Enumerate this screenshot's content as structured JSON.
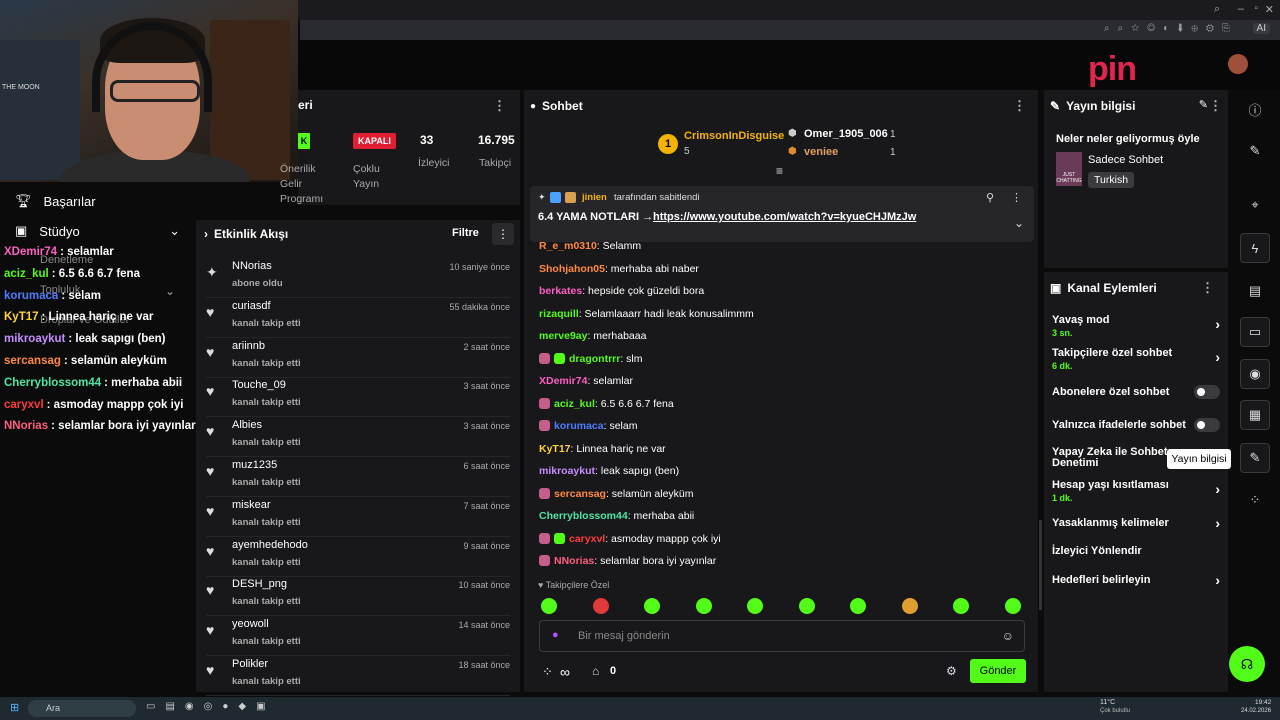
{
  "webcam": {
    "shelf_text": "THE MOON"
  },
  "stats": {
    "partial_title": "eri",
    "badge_left": "K",
    "label_left": "Önerilik\nGelir\nProgramı",
    "status": "KAPALI",
    "status_label": "Çoklu\nYayın",
    "viewers": "33",
    "viewers_label": "İzleyici",
    "followers": "16.795",
    "followers_label": "Takipçi"
  },
  "leftnav": {
    "achievements": "Başarılar",
    "studio": "Stüdyo",
    "denetleme": "Denetleme",
    "topluluk": "Topluluk",
    "dropslar": "Droplar ve Ödüller"
  },
  "overlay_chat": [
    {
      "user": "XDemir74",
      "msg": ": selamlar",
      "color": "#ff5ec4"
    },
    {
      "user": "aciz_kul",
      "msg": ": 6.5 6.6 6.7 fena",
      "color": "#53fc18"
    },
    {
      "user": "korumaca",
      "msg": ": selam",
      "color": "#4f7dff"
    },
    {
      "user": "KyT17",
      "msg": ": Linnea hariç ne var",
      "color": "#ffd23e"
    },
    {
      "user": "mikroaykut",
      "msg": ": leak sapıgı (ben)",
      "color": "#c78cff"
    },
    {
      "user": "sercansag",
      "msg": ": selamün aleyküm",
      "color": "#ff8a3d"
    },
    {
      "user": "Cherryblossom44",
      "msg": ": merhaba abii",
      "color": "#4ee6a4"
    },
    {
      "user": "caryxvl",
      "msg": ": asmoday mappp çok iyi",
      "color": "#ff3b3b"
    },
    {
      "user": "NNorias",
      "msg": ": selamlar bora iyi yayınlar",
      "color": "#ff5e7e"
    }
  ],
  "activity": {
    "title": "Etkinlik Akışı",
    "filter": "Filtre",
    "items": [
      {
        "name": "NNorias",
        "sub": "abone oldu",
        "time": "10 saniye önce",
        "icon": "✦"
      },
      {
        "name": "curiasdf",
        "sub": "kanalı takip etti",
        "time": "55 dakika önce",
        "icon": "♥"
      },
      {
        "name": "ariinnb",
        "sub": "kanalı takip etti",
        "time": "2 saat önce",
        "icon": "♥"
      },
      {
        "name": "Touche_09",
        "sub": "kanalı takip etti",
        "time": "3 saat önce",
        "icon": "♥"
      },
      {
        "name": "Albies",
        "sub": "kanalı takip etti",
        "time": "3 saat önce",
        "icon": "♥"
      },
      {
        "name": "muz1235",
        "sub": "kanalı takip etti",
        "time": "6 saat önce",
        "icon": "♥"
      },
      {
        "name": "miskear",
        "sub": "kanalı takip etti",
        "time": "7 saat önce",
        "icon": "♥"
      },
      {
        "name": "ayemhedehodo",
        "sub": "kanalı takip etti",
        "time": "9 saat önce",
        "icon": "♥"
      },
      {
        "name": "DESH_png",
        "sub": "kanalı takip etti",
        "time": "10 saat önce",
        "icon": "♥"
      },
      {
        "name": "yeowoll",
        "sub": "kanalı takip etti",
        "time": "14 saat önce",
        "icon": "♥"
      },
      {
        "name": "Polikler",
        "sub": "kanalı takip etti",
        "time": "18 saat önce",
        "icon": "♥"
      }
    ]
  },
  "chat": {
    "title": "Sohbet",
    "leader1": {
      "rank": "1",
      "name": "CrimsonInDisguise",
      "count": "5"
    },
    "leader2": {
      "name": "Omer_1905_006",
      "count": "1"
    },
    "leader3": {
      "name": "veniee",
      "count": "1"
    },
    "pinned_by_user": "jinien",
    "pinned_by_text": "tarafından sabitlendi",
    "pinned_msg": "6.4 YAMA NOTLARI →",
    "pinned_link": "https://www.youtube.com/watch?v=kyueCHJMzJw",
    "messages": [
      {
        "user": "R_e_m0310",
        "msg": ": Selamm",
        "color": "#ff8a3d",
        "badge": ""
      },
      {
        "user": "Shohjahon05",
        "msg": ": merhaba abi naber",
        "color": "#ff8a3d",
        "badge": ""
      },
      {
        "user": "berkates",
        "msg": ": hepside çok güzeldi bora",
        "color": "#ff5ec4",
        "badge": ""
      },
      {
        "user": "rizaquill",
        "msg": ": Selamlaaarr hadi leak konusalimmm",
        "color": "#53fc18",
        "badge": ""
      },
      {
        "user": "merve9ay",
        "msg": ": merhabaaa",
        "color": "#53fc18",
        "badge": ""
      },
      {
        "user": "dragontrrr",
        "msg": ": slm",
        "color": "#53fc18",
        "badge": "two"
      },
      {
        "user": "XDemir74",
        "msg": ": selamlar",
        "color": "#ff5ec4",
        "badge": ""
      },
      {
        "user": "aciz_kul",
        "msg": ": 6.5 6.6 6.7 fena",
        "color": "#53fc18",
        "badge": "one"
      },
      {
        "user": "korumaca",
        "msg": ": selam",
        "color": "#4f7dff",
        "badge": "one"
      },
      {
        "user": "KyT17",
        "msg": ": Linnea hariç ne var",
        "color": "#ffd23e",
        "badge": ""
      },
      {
        "user": "mikroaykut",
        "msg": ": leak sapıgı (ben)",
        "color": "#c78cff",
        "badge": ""
      },
      {
        "user": "sercansag",
        "msg": ": selamün aleyküm",
        "color": "#ff8a3d",
        "badge": "one"
      },
      {
        "user": "Cherryblossom44",
        "msg": ": merhaba abii",
        "color": "#4ee6a4",
        "badge": ""
      },
      {
        "user": "caryxvl",
        "msg": ": asmoday mappp çok iyi",
        "color": "#ff3b3b",
        "badge": "two"
      },
      {
        "user": "NNorias",
        "msg": ": selamlar bora iyi yayınlar",
        "color": "#ff5e7e",
        "badge": "one"
      }
    ],
    "followers_only": "♥ Takipçilere Özel",
    "input_placeholder": "Bir mesaj gönderin",
    "points": "∞",
    "chest_count": "0",
    "send": "Gönder"
  },
  "yayin": {
    "title": "Yayın bilgisi",
    "stream_title": "Neler neler geliyormuş öyle",
    "category": "Sadece Sohbet",
    "language": "Turkish",
    "thumb_text": "JUST CHATTING"
  },
  "kanal": {
    "title": "Kanal Eylemleri",
    "slow_mode": "Yavaş mod",
    "slow_val": "3 sn.",
    "follower_chat": "Takipçilere özel sohbet",
    "follower_val": "6 dk.",
    "sub_chat": "Abonelere özel sohbet",
    "emote_chat": "Yalnızca ifadelerle sohbet",
    "ai_mod": "Yapay Zeka ile Sohbet Denetimi",
    "tooltip": "Yayın bilgisi",
    "age_limit": "Hesap yaşı kısıtlaması",
    "age_val": "1 dk.",
    "banned_words": "Yasaklanmış kelimeler",
    "raid": "İzleyici Yönlendir",
    "goals": "Hedefleri belirleyin"
  },
  "logo": "pin",
  "taskbar": {
    "search": "Ara",
    "weather": "11°C",
    "weather_desc": "Çok bulutlu",
    "time": "19:42",
    "date": "24.02.2026"
  }
}
